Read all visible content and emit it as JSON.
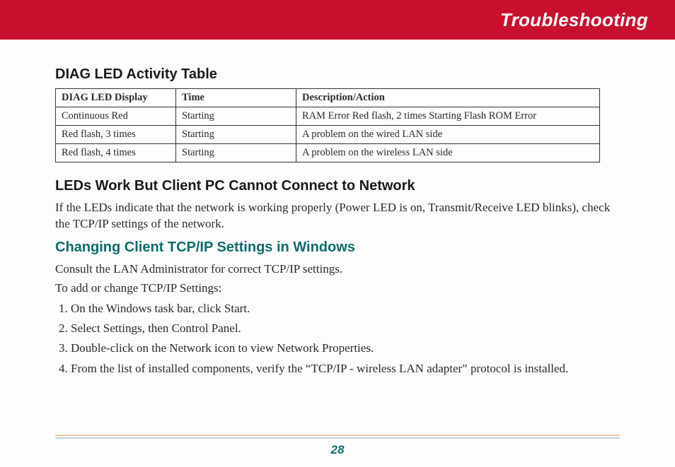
{
  "banner": {
    "title": "Troubleshooting"
  },
  "sections": {
    "diag_title": "DIAG LED Activity Table",
    "leds_title": "LEDs Work But Client PC Cannot Connect to Network",
    "tcpip_title": "Changing Client TCP/IP Settings in Windows"
  },
  "table": {
    "headers": {
      "display": "DIAG LED Display",
      "time": "Time",
      "desc": "Description/Action"
    },
    "rows": [
      {
        "display": "Continuous Red",
        "time": "Starting",
        "desc": "RAM Error Red flash, 2 times Starting Flash ROM Error"
      },
      {
        "display": "Red flash, 3 times",
        "time": "Starting",
        "desc": "A problem on the wired LAN side"
      },
      {
        "display": "Red flash, 4 times",
        "time": "Starting",
        "desc": "A problem on the wireless LAN side"
      }
    ]
  },
  "paragraphs": {
    "leds": "If the LEDs indicate that the network is working properly (Power LED is on, Transmit/Receive LED blinks), check the TCP/IP settings of the network.",
    "consult": "Consult the LAN Administrator for correct TCP/IP settings.",
    "toadd": "To add or change TCP/IP Settings:"
  },
  "steps": [
    "On the Windows task bar, click Start.",
    "Select Settings, then Control Panel.",
    "Double-click on the Network icon to view Network Properties.",
    "From the list of installed components, verify the “TCP/IP - wireless LAN adapter” protocol is installed."
  ],
  "page_number": "28"
}
